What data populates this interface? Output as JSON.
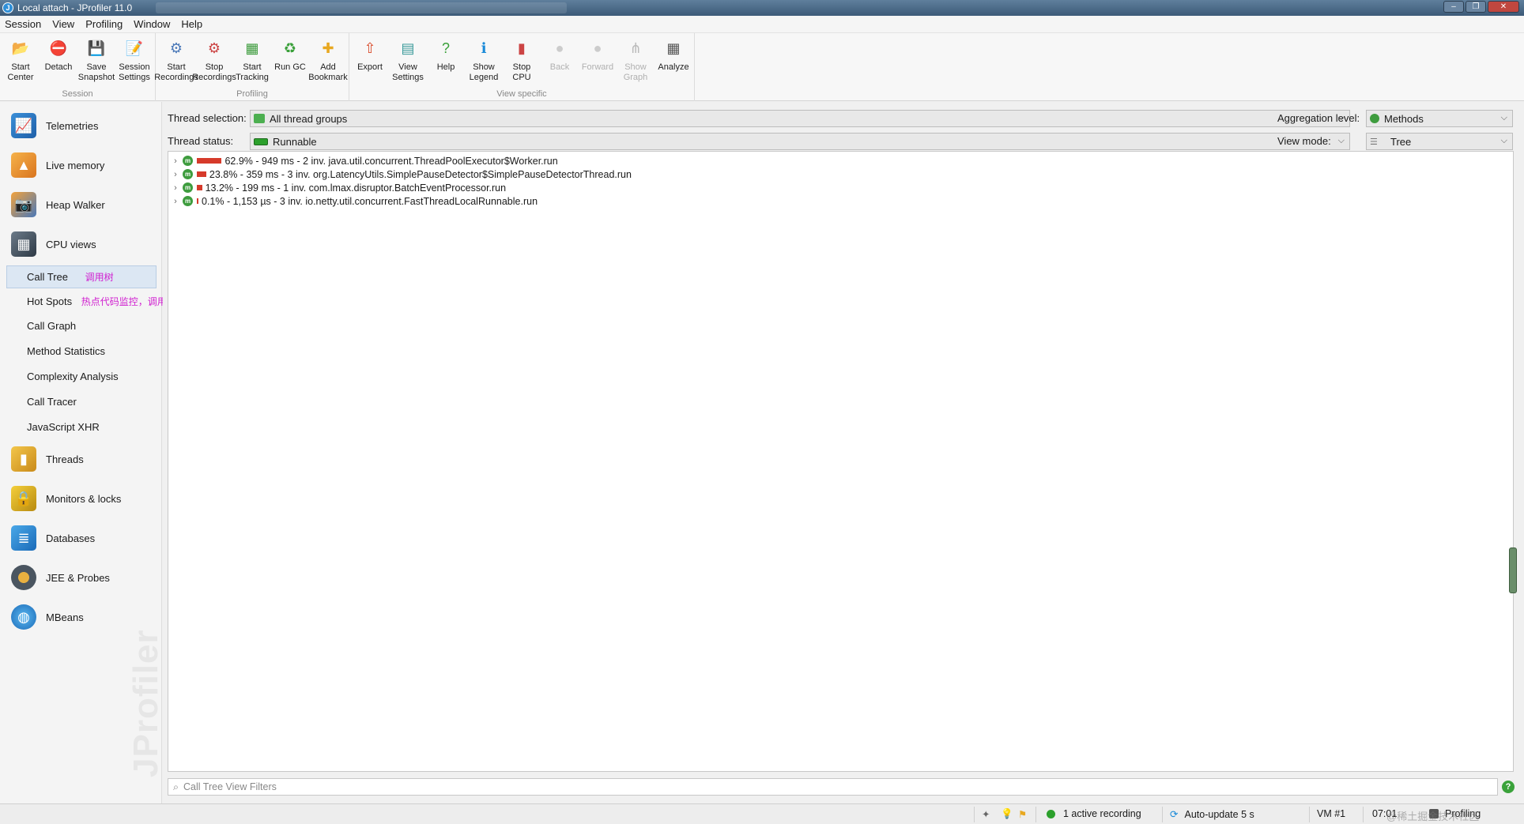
{
  "window": {
    "title": "Local attach - JProfiler 11.0"
  },
  "menu": [
    "Session",
    "View",
    "Profiling",
    "Window",
    "Help"
  ],
  "toolbar": {
    "groups": [
      {
        "label": "Session",
        "buttons": [
          {
            "label": "Start\nCenter",
            "icon": "folder-star-icon",
            "enabled": true
          },
          {
            "label": "Detach",
            "icon": "detach-icon",
            "enabled": true
          },
          {
            "label": "Save\nSnapshot",
            "icon": "save-icon",
            "enabled": true
          },
          {
            "label": "Session\nSettings",
            "icon": "session-settings-icon",
            "enabled": true
          }
        ]
      },
      {
        "label": "Profiling",
        "buttons": [
          {
            "label": "Start\nRecordings",
            "icon": "start-recordings-icon",
            "enabled": true
          },
          {
            "label": "Stop\nRecordings",
            "icon": "stop-recordings-icon",
            "enabled": true
          },
          {
            "label": "Start\nTracking",
            "icon": "start-tracking-icon",
            "enabled": true
          },
          {
            "label": "Run GC",
            "icon": "run-gc-icon",
            "enabled": true
          },
          {
            "label": "Add\nBookmark",
            "icon": "add-bookmark-icon",
            "enabled": true
          }
        ]
      },
      {
        "label": "View specific",
        "buttons": [
          {
            "label": "Export",
            "icon": "export-icon",
            "enabled": true
          },
          {
            "label": "View\nSettings",
            "icon": "view-settings-icon",
            "enabled": true
          },
          {
            "label": "Help",
            "icon": "help-icon",
            "enabled": true
          },
          {
            "label": "Show\nLegend",
            "icon": "legend-icon",
            "enabled": true
          },
          {
            "label": "Stop\nCPU",
            "icon": "stop-cpu-icon",
            "enabled": true
          },
          {
            "label": "Back",
            "icon": "back-icon",
            "enabled": false
          },
          {
            "label": "Forward",
            "icon": "forward-icon",
            "enabled": false
          },
          {
            "label": "Show\nGraph",
            "icon": "graph-icon",
            "enabled": false
          },
          {
            "label": "Analyze",
            "icon": "analyze-icon",
            "enabled": true
          }
        ]
      }
    ]
  },
  "sidebar": {
    "items": [
      {
        "label": "Telemetries",
        "icon": "telemetries-icon"
      },
      {
        "label": "Live memory",
        "icon": "live-memory-icon"
      },
      {
        "label": "Heap Walker",
        "icon": "heap-walker-icon"
      },
      {
        "label": "CPU views",
        "icon": "cpu-views-icon"
      }
    ],
    "cpu_sub": [
      "Call Tree",
      "Hot Spots",
      "Call Graph",
      "Method Statistics",
      "Complexity Analysis",
      "Call Tracer",
      "JavaScript XHR"
    ],
    "items_after": [
      {
        "label": "Threads",
        "icon": "threads-icon"
      },
      {
        "label": "Monitors & locks",
        "icon": "lock-icon"
      },
      {
        "label": "Databases",
        "icon": "databases-icon"
      },
      {
        "label": "JEE & Probes",
        "icon": "probes-icon"
      },
      {
        "label": "MBeans",
        "icon": "mbeans-icon"
      }
    ],
    "annotations": {
      "call_tree": "调用树",
      "hot_spots": "热点代码监控，调用次数、平均耗时都在这个视图查看"
    },
    "watermark": "JProfiler"
  },
  "controls": {
    "thread_selection_label": "Thread selection:",
    "thread_selection_value": "All thread groups",
    "thread_status_label": "Thread status:",
    "thread_status_value": "Runnable",
    "aggregation_label": "Aggregation level:",
    "aggregation_value": "Methods",
    "view_mode_label": "View mode:",
    "view_mode_value": "Tree"
  },
  "tree": {
    "rows": [
      {
        "text": "62.9% - 949 ms - 2 inv. java.util.concurrent.ThreadPoolExecutor$Worker.run",
        "pct": 62.9
      },
      {
        "text": "23.8% - 359 ms - 3 inv. org.LatencyUtils.SimplePauseDetector$SimplePauseDetectorThread.run",
        "pct": 23.8
      },
      {
        "text": "13.2% - 199 ms - 1 inv. com.lmax.disruptor.BatchEventProcessor.run",
        "pct": 13.2
      },
      {
        "text": "0.1% - 1,153 µs - 3 inv. io.netty.util.concurrent.FastThreadLocalRunnable.run",
        "pct": 0.1
      }
    ]
  },
  "filter": {
    "placeholder": "Call Tree View Filters"
  },
  "status": {
    "recording": "1 active recording",
    "autoupdate": "Auto-update 5 s",
    "vm": "VM #1",
    "time": "07:01",
    "mode": "Profiling",
    "watermark": "@稀土掘金技术社区"
  },
  "colors": {
    "accent_bar": "#d63a2b",
    "annotation": "#d020d0",
    "method_icon": "#3e9c3e"
  }
}
